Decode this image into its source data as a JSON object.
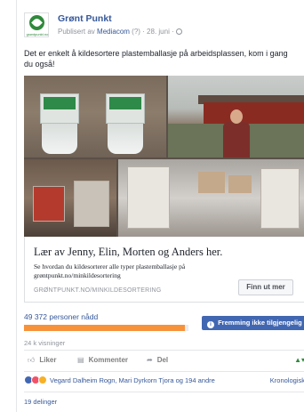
{
  "post": {
    "page_name": "Grønt Punkt",
    "logo_text": "grøntpunkt.no",
    "meta_prefix": "Publisert av",
    "meta_publisher": "Mediacom",
    "meta_suffix": "(?) · 28. juni ·",
    "text": "Det er enkelt å kildesortere plastemballasje på arbeidsplassen, kom i gang du også!"
  },
  "link_preview": {
    "title": "Lær av Jenny, Elin, Morten og Anders her.",
    "description": "Se hvordan du kildesorterer alle typer plastemballasje på grøntpunkt.no/minkildesortering",
    "domain": "GRØNTPUNKT.NO/MINKILDESORTERING",
    "cta": "Finn ut mer"
  },
  "insights": {
    "reach_text": "49 372 personer nådd",
    "reach_fill_fraction": 0.98,
    "boost_label": "Fremming ikke tilgjengelig",
    "views": "24 k visninger"
  },
  "actions": {
    "like": "Liker",
    "comment": "Kommenter",
    "share": "Del"
  },
  "reactions": {
    "names": "Vegard Dalheim Rogn, Mari Dyrkorn Tjora og 194 andre",
    "sort": "Kronologisk",
    "shares": "19 delinger"
  },
  "icons": {
    "like": "thumbs-up-icon",
    "comment": "comment-icon",
    "share": "share-arrow-icon",
    "globe": "globe-icon",
    "info": "info-icon"
  },
  "colors": {
    "link": "#365899",
    "boost": "#4267b2",
    "reach_bar": "#f7923a",
    "brand": "#2f8a3b"
  }
}
